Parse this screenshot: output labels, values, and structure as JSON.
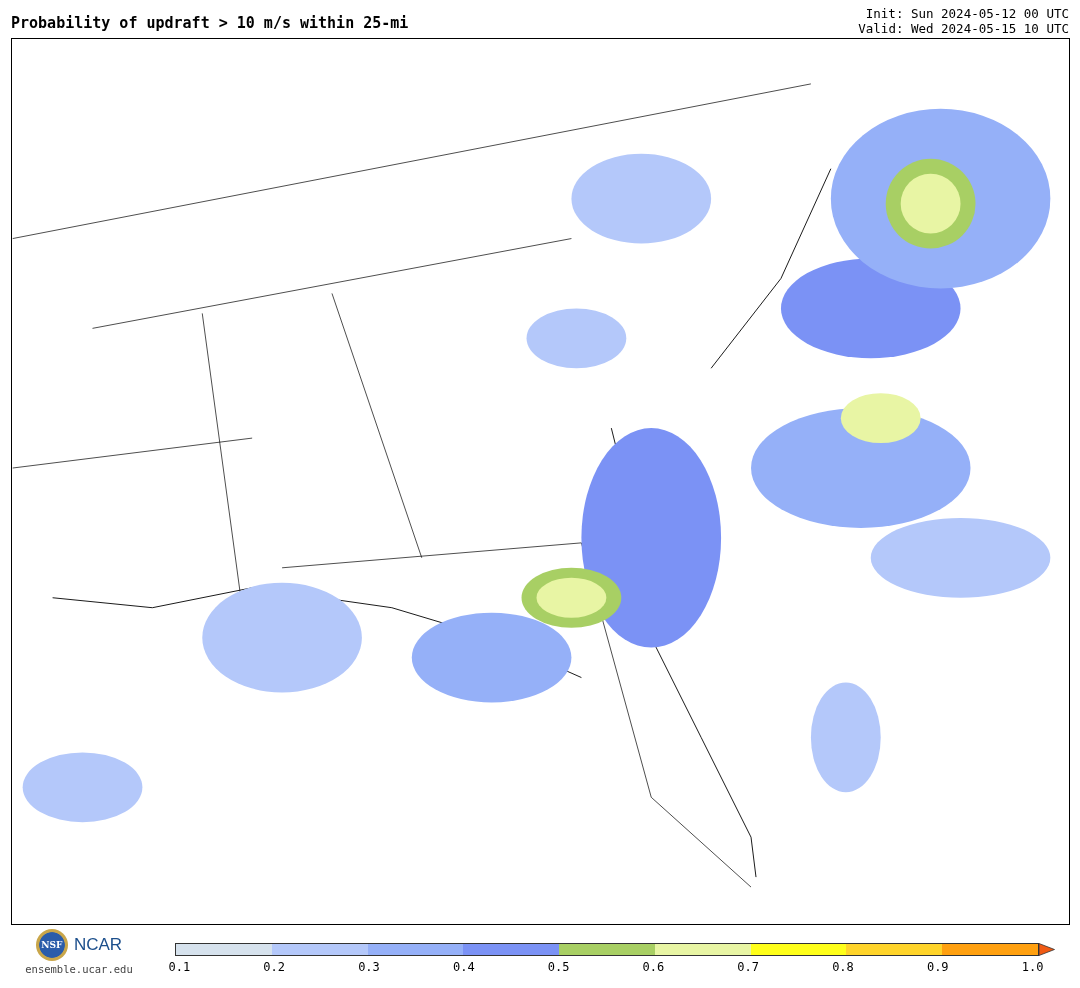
{
  "header": {
    "title": "Probability of updraft > 10 m/s within 25-mi",
    "init": "Init: Sun 2024-05-12 00 UTC",
    "valid": "Valid: Wed 2024-05-15 10 UTC"
  },
  "footer": {
    "logo_left": "NSF",
    "logo_right": "NCAR",
    "site": "ensemble.ucar.edu"
  },
  "legend": {
    "bins": [
      {
        "color": "#d6e2ed"
      },
      {
        "color": "#b4c8fa"
      },
      {
        "color": "#95b0f8"
      },
      {
        "color": "#7b92f5"
      },
      {
        "color": "#a8cf64"
      },
      {
        "color": "#e8f5a4"
      },
      {
        "color": "#ffff1a"
      },
      {
        "color": "#ffd42a"
      },
      {
        "color": "#ffa010"
      },
      {
        "color": "#f05a14"
      }
    ],
    "ticks": [
      "0.1",
      "0.2",
      "0.3",
      "0.4",
      "0.5",
      "0.6",
      "0.7",
      "0.8",
      "0.9",
      "1.0"
    ]
  }
}
